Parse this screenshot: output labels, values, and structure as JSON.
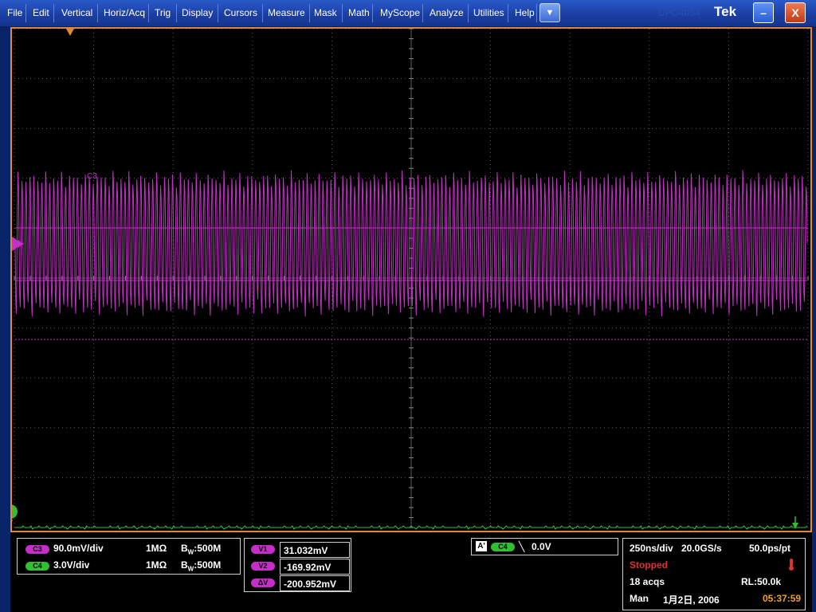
{
  "menu": [
    {
      "label": "File"
    },
    {
      "label": "Edit"
    },
    {
      "label": "Vertical"
    },
    {
      "label": "Horiz/Acq"
    },
    {
      "label": "Trig"
    },
    {
      "label": "Display"
    },
    {
      "label": "Cursors"
    },
    {
      "label": "Measure"
    },
    {
      "label": "Mask"
    },
    {
      "label": "Math"
    },
    {
      "label": "MyScope"
    },
    {
      "label": "Analyze"
    },
    {
      "label": "Utilities"
    },
    {
      "label": "Help"
    }
  ],
  "brand": "Tek",
  "brand_faint": "DPO4054",
  "window": {
    "dropdown": "▼",
    "minimize": "–",
    "close": "X"
  },
  "colors": {
    "c3": "#c62ec9",
    "c4": "#30c030",
    "frame": "#e0883a",
    "grid": "#5a5a5a",
    "background": "#000000"
  },
  "waveform_markers": {
    "c3_label": "3",
    "c4_label": "4",
    "cursor_label": "C3"
  },
  "channels": [
    {
      "badge": "C3",
      "scale": "90.0mV/div",
      "impedance": "1MΩ",
      "bw_prefix": "B",
      "bw_sub": "W",
      "bw": ":500M"
    },
    {
      "badge": "C4",
      "scale": "3.0V/div",
      "impedance": "1MΩ",
      "bw_prefix": "B",
      "bw_sub": "W",
      "bw": ":500M"
    }
  ],
  "cursors": [
    {
      "badge": "V1",
      "value": "31.032mV"
    },
    {
      "badge": "V2",
      "value": "-169.92mV"
    },
    {
      "badge": "ΔV",
      "value": "-200.952mV"
    }
  ],
  "trigger": {
    "mode": "A'",
    "source": "C4",
    "slope": "╲",
    "level": "0.0V"
  },
  "acquisition": {
    "timebase": "250ns/div",
    "sample_rate": "20.0GS/s",
    "resolution": "50.0ps/pt",
    "status": "Stopped",
    "acqs": "18 acqs",
    "record_length": "RL:50.0k",
    "mode": "Man",
    "date": "1月2日, 2006",
    "time": "05:37:59"
  }
}
